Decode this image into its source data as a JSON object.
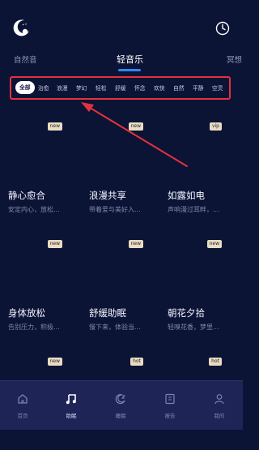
{
  "tabs": [
    {
      "label": "自然音"
    },
    {
      "label": "轻音乐"
    },
    {
      "label": "冥想"
    }
  ],
  "categories": [
    "全部",
    "治愈",
    "浪漫",
    "梦幻",
    "轻松",
    "舒缓",
    "怀念",
    "欢快",
    "自然",
    "平静",
    "空灵"
  ],
  "cards": [
    {
      "title": "静心愈合",
      "subtitle": "安定内心，放松...",
      "badge": "new"
    },
    {
      "title": "浪漫共享",
      "subtitle": "带着爱与美好入...",
      "badge": "new"
    },
    {
      "title": "如露如电",
      "subtitle": "声响漫过耳畔，...",
      "badge": "vip"
    },
    {
      "title": "身体放松",
      "subtitle": "告别压力，积极...",
      "badge": "new"
    },
    {
      "title": "舒缓助眠",
      "subtitle": "慢下来，体验当...",
      "badge": "new"
    },
    {
      "title": "朝花夕拾",
      "subtitle": "轻嗅花香，梦里...",
      "badge": "new"
    },
    {
      "badge": "new"
    },
    {
      "badge": "hot"
    },
    {
      "badge": "hot"
    }
  ],
  "nav": [
    {
      "label": "首页",
      "icon": "home-icon"
    },
    {
      "label": "助眠",
      "icon": "music-note-icon"
    },
    {
      "label": "睡眠",
      "icon": "moon-zz-icon"
    },
    {
      "label": "报告",
      "icon": "report-icon"
    },
    {
      "label": "我的",
      "icon": "user-icon"
    }
  ],
  "colors": {
    "background": "#0c1436",
    "accent": "#2f86ff",
    "highlight": "#e2333b",
    "badge": "#e9dcc0",
    "nav": "#1e2456"
  }
}
